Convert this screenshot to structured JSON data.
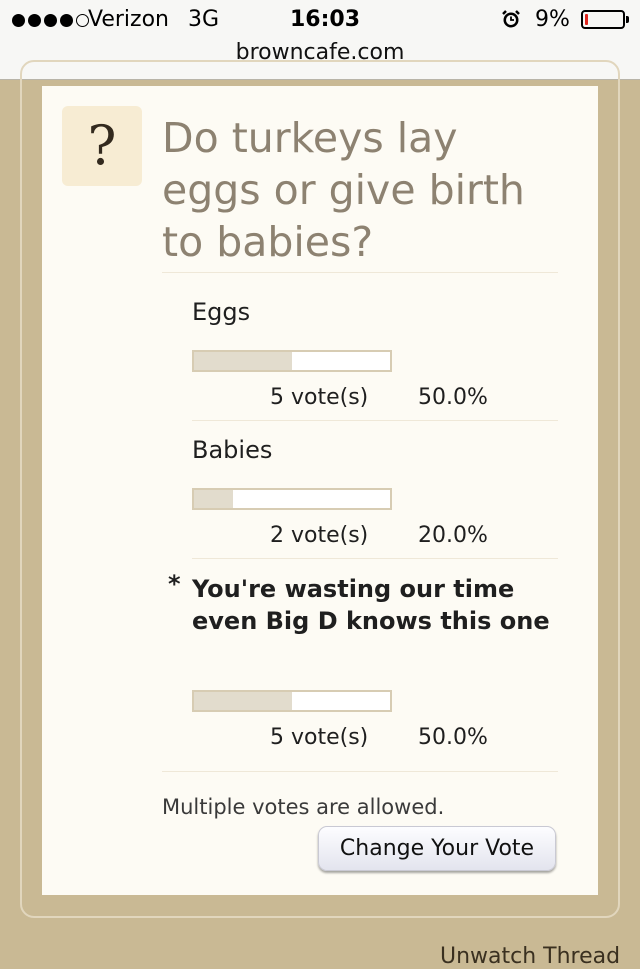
{
  "status_bar": {
    "carrier": "Verizon",
    "network": "3G",
    "time": "16:03",
    "battery_percent": "9%",
    "battery_level": 0.09,
    "signal_bars": 4,
    "signal_max": 5,
    "icons": [
      "signal-dots-icon",
      "alarm-clock-icon",
      "battery-icon"
    ]
  },
  "browser": {
    "url": "browncafe.com"
  },
  "poll": {
    "icon_glyph": "?",
    "question": "Do turkeys lay eggs or give birth to babies?",
    "options": [
      {
        "label": "Eggs",
        "votes_text": "5 vote(s)",
        "percent_text": "50.0%",
        "percent": 50.0,
        "voted": false
      },
      {
        "label": "Babies",
        "votes_text": "2 vote(s)",
        "percent_text": "20.0%",
        "percent": 20.0,
        "voted": false
      },
      {
        "label": "You're wasting our time even Big D knows this one",
        "votes_text": "5 vote(s)",
        "percent_text": "50.0%",
        "percent": 50.0,
        "voted": true,
        "voted_marker": "*"
      }
    ],
    "note": "Multiple votes are allowed.",
    "change_vote_label": "Change Your Vote"
  },
  "footer": {
    "unwatch_label": "Unwatch Thread"
  },
  "colors": {
    "background": "#c9b994",
    "card": "#fdfbf4",
    "question_text": "#8d8271",
    "bar_fill": "#e2dccd",
    "bar_border": "#d7ccb3",
    "battery_low": "#e0261e"
  }
}
